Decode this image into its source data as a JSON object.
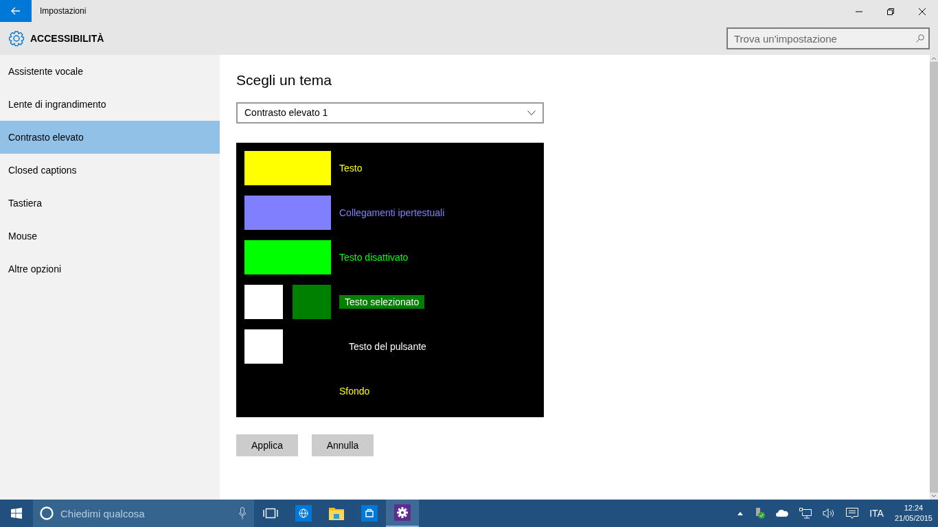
{
  "window": {
    "title": "Impostazioni"
  },
  "header": {
    "title": "ACCESSIBILITÀ",
    "search": {
      "placeholder": "Trova un'impostazione"
    }
  },
  "sidebar": {
    "items": [
      {
        "label": "Assistente vocale",
        "selected": false
      },
      {
        "label": "Lente di ingrandimento",
        "selected": false
      },
      {
        "label": "Contrasto elevato",
        "selected": true
      },
      {
        "label": "Closed captions",
        "selected": false
      },
      {
        "label": "Tastiera",
        "selected": false
      },
      {
        "label": "Mouse",
        "selected": false
      },
      {
        "label": "Altre opzioni",
        "selected": false
      }
    ]
  },
  "content": {
    "heading": "Scegli un tema",
    "theme_dropdown": {
      "value": "Contrasto elevato 1"
    },
    "preview": [
      {
        "kind": "swatch",
        "label": "Testo",
        "color": "#ffff00",
        "swatches": [
          {
            "color": "#ffff00"
          }
        ]
      },
      {
        "kind": "swatch",
        "label": "Collegamenti ipertestuali",
        "color": "#8080ff",
        "swatches": [
          {
            "color": "#8080ff"
          }
        ]
      },
      {
        "kind": "swatch",
        "label": "Testo disattivato",
        "color": "#00ff00",
        "swatches": [
          {
            "color": "#00ff00"
          }
        ]
      },
      {
        "kind": "highlight",
        "label": "Testo selezionato",
        "swatches": [
          {
            "color": "#ffffff"
          },
          {
            "color": "#008000"
          }
        ]
      },
      {
        "kind": "button",
        "label": "Testo del pulsante",
        "color": "#ffffff",
        "swatches": [
          {
            "color": "#ffffff"
          }
        ]
      },
      {
        "kind": "plain",
        "label": "Sfondo",
        "color": "#ffff00"
      }
    ],
    "buttons": [
      "Applica",
      "Annulla"
    ]
  },
  "taskbar": {
    "search_placeholder": "Chiedimi qualcosa",
    "language": "ITA",
    "time": "12:24",
    "date": "21/05/2015"
  }
}
